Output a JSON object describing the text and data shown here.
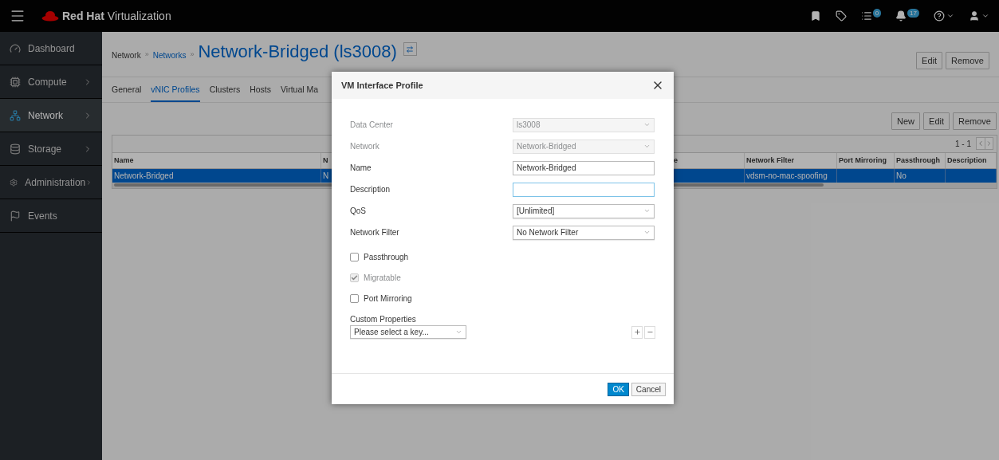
{
  "header": {
    "brand_bold": "Red Hat",
    "brand_rest": "Virtualization",
    "icons": [
      {
        "kind": "bookmark"
      },
      {
        "kind": "tag"
      },
      {
        "kind": "tasks",
        "badge": "0"
      },
      {
        "kind": "bell",
        "badge": "17"
      },
      {
        "kind": "help",
        "caret": true
      },
      {
        "kind": "user",
        "caret": true
      }
    ]
  },
  "sidebar": {
    "items": [
      {
        "label": "Dashboard",
        "kind": "dashboard",
        "expandable": false,
        "selected": false
      },
      {
        "label": "Compute",
        "kind": "compute",
        "expandable": true,
        "selected": false
      },
      {
        "label": "Network",
        "kind": "network",
        "expandable": true,
        "selected": true
      },
      {
        "label": "Storage",
        "kind": "storage",
        "expandable": true,
        "selected": false
      },
      {
        "label": "Administration",
        "kind": "admin",
        "expandable": true,
        "selected": false
      },
      {
        "label": "Events",
        "kind": "events",
        "expandable": false,
        "selected": false
      }
    ]
  },
  "page": {
    "breadcrumb": [
      {
        "kind": "text",
        "label": "Network"
      },
      {
        "kind": "separator",
        "label": "»"
      },
      {
        "kind": "link",
        "label": "Networks"
      },
      {
        "kind": "separator",
        "label": "»"
      }
    ],
    "title": "Network-Bridged (ls3008)",
    "header_buttons": [
      "Edit",
      "Remove"
    ],
    "tabs": [
      {
        "label": "General",
        "selected": false
      },
      {
        "label": "vNIC Profiles",
        "selected": true
      },
      {
        "label": "Clusters",
        "selected": false
      },
      {
        "label": "Hosts",
        "selected": false
      },
      {
        "label": "Virtual Ma",
        "selected": false
      }
    ],
    "table_buttons": [
      "New",
      "Edit",
      "Remove"
    ],
    "pagination": "1 - 1",
    "table": {
      "columns": [
        "Name",
        "N",
        "e",
        "Network Filter",
        "Port Mirroring",
        "Passthrough",
        "Description"
      ],
      "rows": [
        {
          "cells": [
            "Network-Bridged",
            "N",
            "",
            "vdsm-no-mac-spoofing",
            "",
            "No",
            ""
          ],
          "selected": true
        }
      ]
    }
  },
  "modal": {
    "title": "VM Interface Profile",
    "fields": [
      {
        "label": "Data Center",
        "kind": "select",
        "value": "ls3008",
        "disabled": true,
        "focused": false
      },
      {
        "label": "Network",
        "kind": "select",
        "value": "Network-Bridged",
        "disabled": true,
        "focused": false
      },
      {
        "label": "Name",
        "kind": "text",
        "value": "Network-Bridged",
        "disabled": false,
        "focused": false
      },
      {
        "label": "Description",
        "kind": "text",
        "disabled": false,
        "focused": true
      },
      {
        "label": "QoS",
        "kind": "select",
        "value": "[Unlimited]",
        "disabled": false,
        "focused": false
      },
      {
        "label": "Network Filter",
        "kind": "select",
        "value": "No Network Filter",
        "disabled": false,
        "focused": false
      }
    ],
    "checkboxes": [
      {
        "label": "Passthrough",
        "checked": false,
        "disabled": false
      },
      {
        "label": "Migratable",
        "checked": true,
        "disabled": true
      },
      {
        "label": "Port Mirroring",
        "checked": false,
        "disabled": false
      }
    ],
    "custom_properties": {
      "label": "Custom Properties",
      "placeholder": "Please select a key..."
    },
    "buttons": [
      {
        "label": "OK",
        "primary": true
      },
      {
        "label": "Cancel",
        "primary": false
      }
    ]
  }
}
